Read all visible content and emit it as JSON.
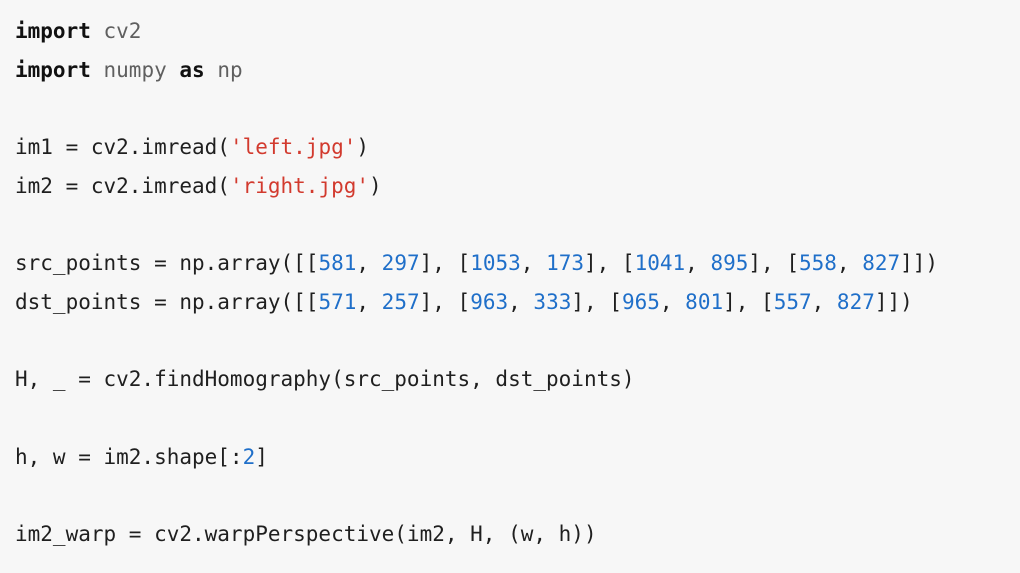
{
  "code": {
    "line1": {
      "kw": "import",
      "sp": " ",
      "mod": "cv2"
    },
    "line2": {
      "kw1": "import",
      "sp1": " ",
      "mod": "numpy",
      "sp2": " ",
      "kw2": "as",
      "sp3": " ",
      "alias": "np"
    },
    "line4": {
      "pre": "im1 = cv2.imread(",
      "str": "'left.jpg'",
      "post": ")"
    },
    "line5": {
      "pre": "im2 = cv2.imread(",
      "str": "'right.jpg'",
      "post": ")"
    },
    "line7": {
      "pre": "src_points = np.array([[",
      "n1": "581",
      "s1": ", ",
      "n2": "297",
      "s2": "], [",
      "n3": "1053",
      "s3": ", ",
      "n4": "173",
      "s4": "], [",
      "n5": "1041",
      "s5": ", ",
      "n6": "895",
      "s6": "], [",
      "n7": "558",
      "s7": ", ",
      "n8": "827",
      "post": "]])"
    },
    "line8": {
      "pre": "dst_points = np.array([[",
      "n1": "571",
      "s1": ", ",
      "n2": "257",
      "s2": "], [",
      "n3": "963",
      "s3": ", ",
      "n4": "333",
      "s4": "], [",
      "n5": "965",
      "s5": ", ",
      "n6": "801",
      "s6": "], [",
      "n7": "557",
      "s7": ", ",
      "n8": "827",
      "post": "]])"
    },
    "line10": {
      "text": "H, _ = cv2.findHomography(src_points, dst_points)"
    },
    "line12": {
      "pre": "h, w = im2.shape[:",
      "num": "2",
      "post": "]"
    },
    "line14": {
      "text": "im2_warp = cv2.warpPerspective(im2, H, (w, h))"
    }
  }
}
